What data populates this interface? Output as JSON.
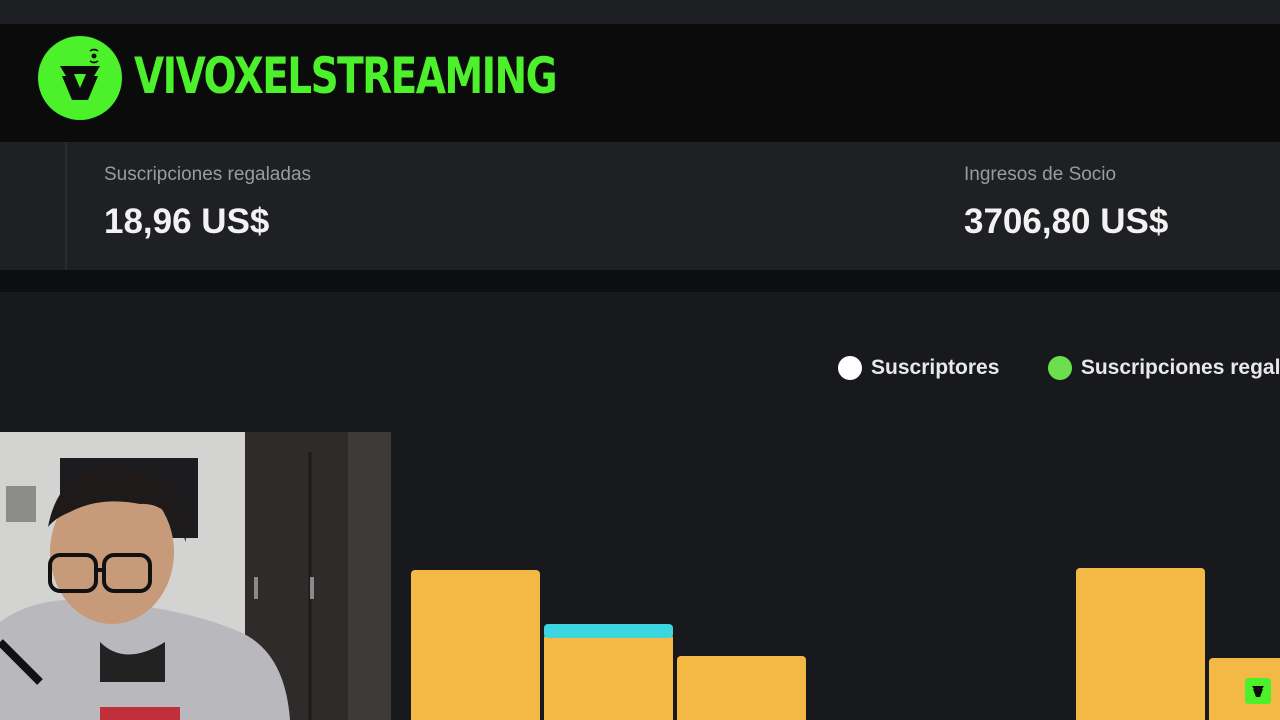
{
  "brand": {
    "name": "VIVOXELSTREAMING",
    "logo_icon": "broadcast-v-logo",
    "accent": "#4cf12b"
  },
  "stats": [
    {
      "label": "Suscripciones regaladas",
      "value": "18,96 US$"
    },
    {
      "label": "Ingresos de Socio",
      "value": "3706,80 US$"
    }
  ],
  "chart_data": {
    "type": "bar",
    "title": "",
    "legend": [
      {
        "name": "Suscriptores",
        "color": "#ffffff"
      },
      {
        "name": "Suscripciones regaladas",
        "color": "#6ce04c"
      }
    ],
    "series": [
      {
        "name": "Suscriptores",
        "color": "#f4b944",
        "values": [
          150,
          86,
          64,
          0,
          0,
          152,
          62
        ]
      },
      {
        "name": "Suscripciones regaladas",
        "color": "#6ce04c",
        "values": [
          0,
          0,
          0,
          0,
          0,
          0,
          0
        ]
      },
      {
        "name": "",
        "color": "#3bd6e0",
        "values": [
          0,
          10,
          0,
          0,
          0,
          0,
          0
        ]
      }
    ],
    "legend_position": "top-right",
    "grid": false
  },
  "webcam": {
    "description_icon": "webcam-feed"
  },
  "corner_logo": "vivoxel-small-logo-icon"
}
